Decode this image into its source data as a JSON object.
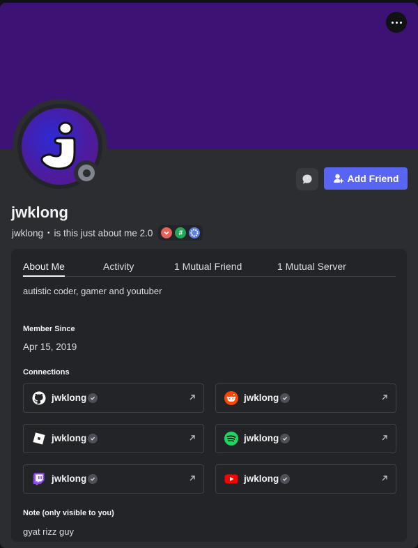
{
  "profile": {
    "display_name": "jwklong",
    "username": "jwklong",
    "pronouns_separator": "•",
    "custom_status": "is this just about me 2.0",
    "badges": [
      "reddit-red-badge",
      "hashtag-green-badge",
      "gear-blue-badge"
    ]
  },
  "actions": {
    "message_icon": "message-bubble-icon",
    "add_friend_label": "Add Friend",
    "more_icon": "ellipsis-icon"
  },
  "tabs": [
    {
      "label": "About Me",
      "active": true
    },
    {
      "label": "Activity",
      "active": false
    },
    {
      "label": "1 Mutual Friend",
      "active": false
    },
    {
      "label": "1 Mutual Server",
      "active": false
    }
  ],
  "about": {
    "bio": "autistic coder, gamer and youtuber",
    "member_since_heading": "Member Since",
    "member_since": "Apr 15, 2019",
    "connections_heading": "Connections",
    "connections": [
      {
        "service": "github",
        "name": "jwklong"
      },
      {
        "service": "reddit",
        "name": "jwklong"
      },
      {
        "service": "roblox",
        "name": "jwklong"
      },
      {
        "service": "spotify",
        "name": "jwklong"
      },
      {
        "service": "twitch",
        "name": "jwklong"
      },
      {
        "service": "youtube",
        "name": "jwklong"
      }
    ],
    "note_heading": "Note (only visible to you)",
    "note": "gyat rizz guy"
  },
  "colors": {
    "banner": "#3c1275",
    "accent": "#5865f2",
    "background": "#2b2d31",
    "card": "#232428"
  }
}
